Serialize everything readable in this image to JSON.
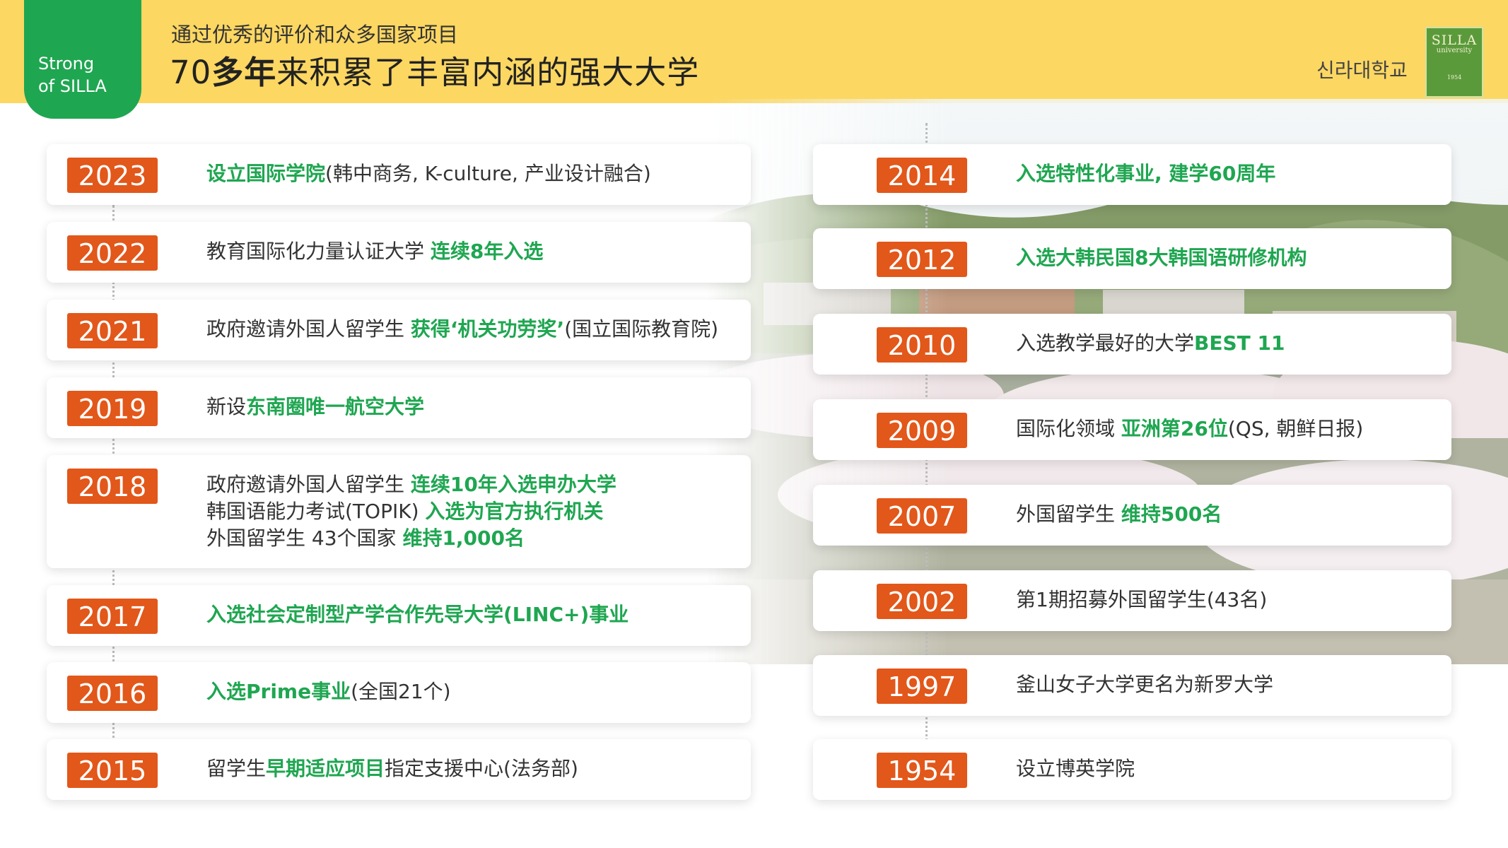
{
  "header": {
    "badge_line1": "Strong",
    "badge_line2": "of SILLA",
    "subtitle": "通过优秀的评价和众多国家项目",
    "title_a": "70",
    "title_b": "多年",
    "title_c": "来积累了丰富内涵的强大大学",
    "korean_name": "신라대학교",
    "logo_line1": "SILLA",
    "logo_line2": "university",
    "logo_line3": "1954"
  },
  "colors": {
    "accent_green": "#1fa651",
    "year_orange": "#e2571a",
    "header_yellow": "#fcd762"
  },
  "left": [
    {
      "year": "2023",
      "lines": [
        [
          {
            "t": "设立国际学院",
            "g": true
          },
          {
            "t": "(韩中商务, K-culture, 产业设计融合)",
            "g": false
          }
        ]
      ]
    },
    {
      "year": "2022",
      "lines": [
        [
          {
            "t": "教育国际化力量认证大学 ",
            "g": false
          },
          {
            "t": "连续8年入选",
            "g": true
          }
        ]
      ]
    },
    {
      "year": "2021",
      "lines": [
        [
          {
            "t": "政府邀请外国人留学生 ",
            "g": false
          },
          {
            "t": "获得‘机关功劳奖’",
            "g": true
          },
          {
            "t": "(国立国际教育院)",
            "g": false
          }
        ]
      ]
    },
    {
      "year": "2019",
      "lines": [
        [
          {
            "t": "新设",
            "g": false
          },
          {
            "t": "东南圈唯一航空大学",
            "g": true
          }
        ]
      ]
    },
    {
      "year": "2018",
      "lines": [
        [
          {
            "t": "政府邀请外国人留学生 ",
            "g": false
          },
          {
            "t": "连续10年入选申办大学",
            "g": true
          }
        ],
        [
          {
            "t": "韩国语能力考试(TOPIK) ",
            "g": false
          },
          {
            "t": "入选为官方执行机关",
            "g": true
          }
        ],
        [
          {
            "t": "外国留学生 43个国家 ",
            "g": false
          },
          {
            "t": "维持1,000名",
            "g": true
          }
        ]
      ]
    },
    {
      "year": "2017",
      "lines": [
        [
          {
            "t": "入选社会定制型产学合作先导大学(LINC+)事业",
            "g": true
          }
        ]
      ]
    },
    {
      "year": "2016",
      "lines": [
        [
          {
            "t": "入选Prime事业",
            "g": true
          },
          {
            "t": "(全国21个)",
            "g": false
          }
        ]
      ]
    },
    {
      "year": "2015",
      "lines": [
        [
          {
            "t": "留学生",
            "g": false
          },
          {
            "t": "早期适应项目",
            "g": true
          },
          {
            "t": "指定支援中心(法务部)",
            "g": false
          }
        ]
      ]
    }
  ],
  "right": [
    {
      "year": "2014",
      "lines": [
        [
          {
            "t": "入选特性化事业, 建学60周年",
            "g": true
          }
        ]
      ]
    },
    {
      "year": "2012",
      "lines": [
        [
          {
            "t": "入选大韩民国8大韩国语研修机构",
            "g": true
          }
        ]
      ]
    },
    {
      "year": "2010",
      "lines": [
        [
          {
            "t": "入选教学最好的大学",
            "g": false
          },
          {
            "t": "BEST 11",
            "g": true
          }
        ]
      ]
    },
    {
      "year": "2009",
      "lines": [
        [
          {
            "t": "国际化领域 ",
            "g": false
          },
          {
            "t": "亚洲第26位",
            "g": true
          },
          {
            "t": "(QS, 朝鲜日报)",
            "g": false
          }
        ]
      ]
    },
    {
      "year": "2007",
      "lines": [
        [
          {
            "t": "外国留学生 ",
            "g": false
          },
          {
            "t": "维持500名",
            "g": true
          }
        ]
      ]
    },
    {
      "year": "2002",
      "lines": [
        [
          {
            "t": "第1期招募外国留学生(43名)",
            "g": false
          }
        ]
      ]
    },
    {
      "year": "1997",
      "lines": [
        [
          {
            "t": "釜山女子大学更名为新罗大学",
            "g": false
          }
        ]
      ]
    },
    {
      "year": "1954",
      "lines": [
        [
          {
            "t": "设立博英学院",
            "g": false
          }
        ]
      ]
    }
  ]
}
